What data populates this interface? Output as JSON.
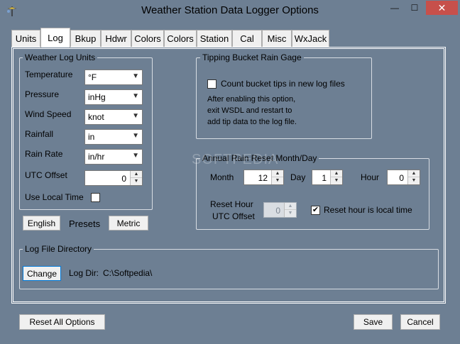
{
  "window": {
    "title": "Weather Station Data Logger Options",
    "min_glyph": "—",
    "max_glyph": "☐",
    "close_glyph": "✕"
  },
  "tabs": [
    {
      "label": "Units"
    },
    {
      "label": "Log",
      "active": true
    },
    {
      "label": "Bkup"
    },
    {
      "label": "Hdwr"
    },
    {
      "label": "Colors"
    },
    {
      "label": "Colors"
    },
    {
      "label": "Station"
    },
    {
      "label": "Cal"
    },
    {
      "label": "Misc"
    },
    {
      "label": "WxJack"
    }
  ],
  "weather_log_units": {
    "title": "Weather Log Units",
    "temperature": {
      "label": "Temperature",
      "value": "°F"
    },
    "pressure": {
      "label": "Pressure",
      "value": "inHg"
    },
    "wind_speed": {
      "label": "Wind Speed",
      "value": "knot"
    },
    "rainfall": {
      "label": "Rainfall",
      "value": "in"
    },
    "rain_rate": {
      "label": "Rain Rate",
      "value": "in/hr"
    },
    "utc_offset": {
      "label": "UTC Offset",
      "value": "0"
    },
    "use_local_time": {
      "label": "Use Local Time",
      "checked": false
    }
  },
  "presets": {
    "english_label": "English",
    "label": "Presets",
    "metric_label": "Metric"
  },
  "tipping_bucket": {
    "title": "Tipping Bucket Rain Gage",
    "checkbox_label": "Count bucket tips in new log files",
    "checked": false,
    "note_line1": "After enabling this option,",
    "note_line2": "exit WSDL and restart to",
    "note_line3": "add tip data to the log file."
  },
  "annual_rain_reset": {
    "title": "Annual Rain Reset Month/Day",
    "month_label": "Month",
    "month_value": "12",
    "day_label": "Day",
    "day_value": "1",
    "hour_label": "Hour",
    "hour_value": "0",
    "reset_hour_label": "Reset Hour",
    "utc_offset_label": "UTC Offset",
    "reset_utc_value": "0",
    "local_time_label": "Reset hour is local time",
    "local_time_checked": true
  },
  "log_dir": {
    "title": "Log File Directory",
    "change_label": "Change",
    "dir_label": "Log Dir:",
    "dir_value": "C:\\Softpedia\\"
  },
  "footer": {
    "reset_all_label": "Reset All Options",
    "save_label": "Save",
    "cancel_label": "Cancel"
  },
  "watermark": "SOFTPEDIA"
}
